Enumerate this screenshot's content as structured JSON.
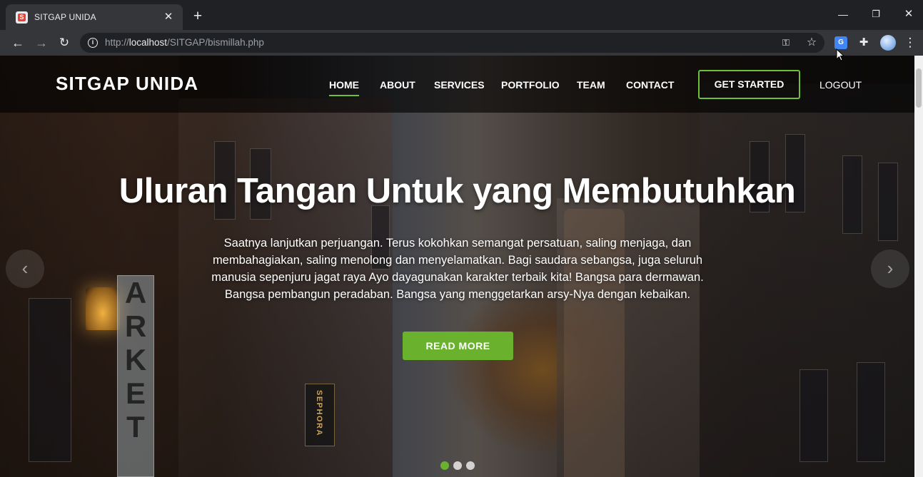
{
  "browser": {
    "tab_title": "SITGAP UNIDA",
    "url_prefix": "http://",
    "url_host": "localhost",
    "url_path": "/SITGAP/bismillah.php",
    "favicon_letter": "S"
  },
  "navbar": {
    "brand": "SITGAP UNIDA",
    "items": [
      {
        "label": "HOME",
        "active": true
      },
      {
        "label": "ABOUT"
      },
      {
        "label": "SERVICES"
      },
      {
        "label": "PORTFOLIO"
      },
      {
        "label": "TEAM"
      },
      {
        "label": "CONTACT"
      }
    ],
    "cta": "GET STARTED",
    "logout": "LOGOUT"
  },
  "hero": {
    "headline": "Uluran Tangan Untuk yang Membutuhkan",
    "lead_lines": [
      "Saatnya lanjutkan perjuangan. Terus kokohkan semangat persatuan, saling menjaga, dan",
      "membahagiakan, saling menolong dan menyelamatkan. Bagi saudara sebangsa, juga seluruh",
      "manusia sepenjuru jagat raya Ayo dayagunakan karakter terbaik kita! Bangsa para dermawan.",
      "Bangsa pembangun peradaban. Bangsa yang menggetarkan arsy-Nya dengan kebaikan."
    ],
    "button": "READ MORE",
    "slides": 3,
    "active_slide": 1,
    "sign_market": [
      "A",
      "R",
      "K",
      "E",
      "T"
    ],
    "sign_sephora": "SEPHORA"
  },
  "colors": {
    "accent": "#6ab12e",
    "accent_border": "#6fbf3a",
    "browser_dark": "#202124",
    "browser_toolbar": "#35363a"
  }
}
